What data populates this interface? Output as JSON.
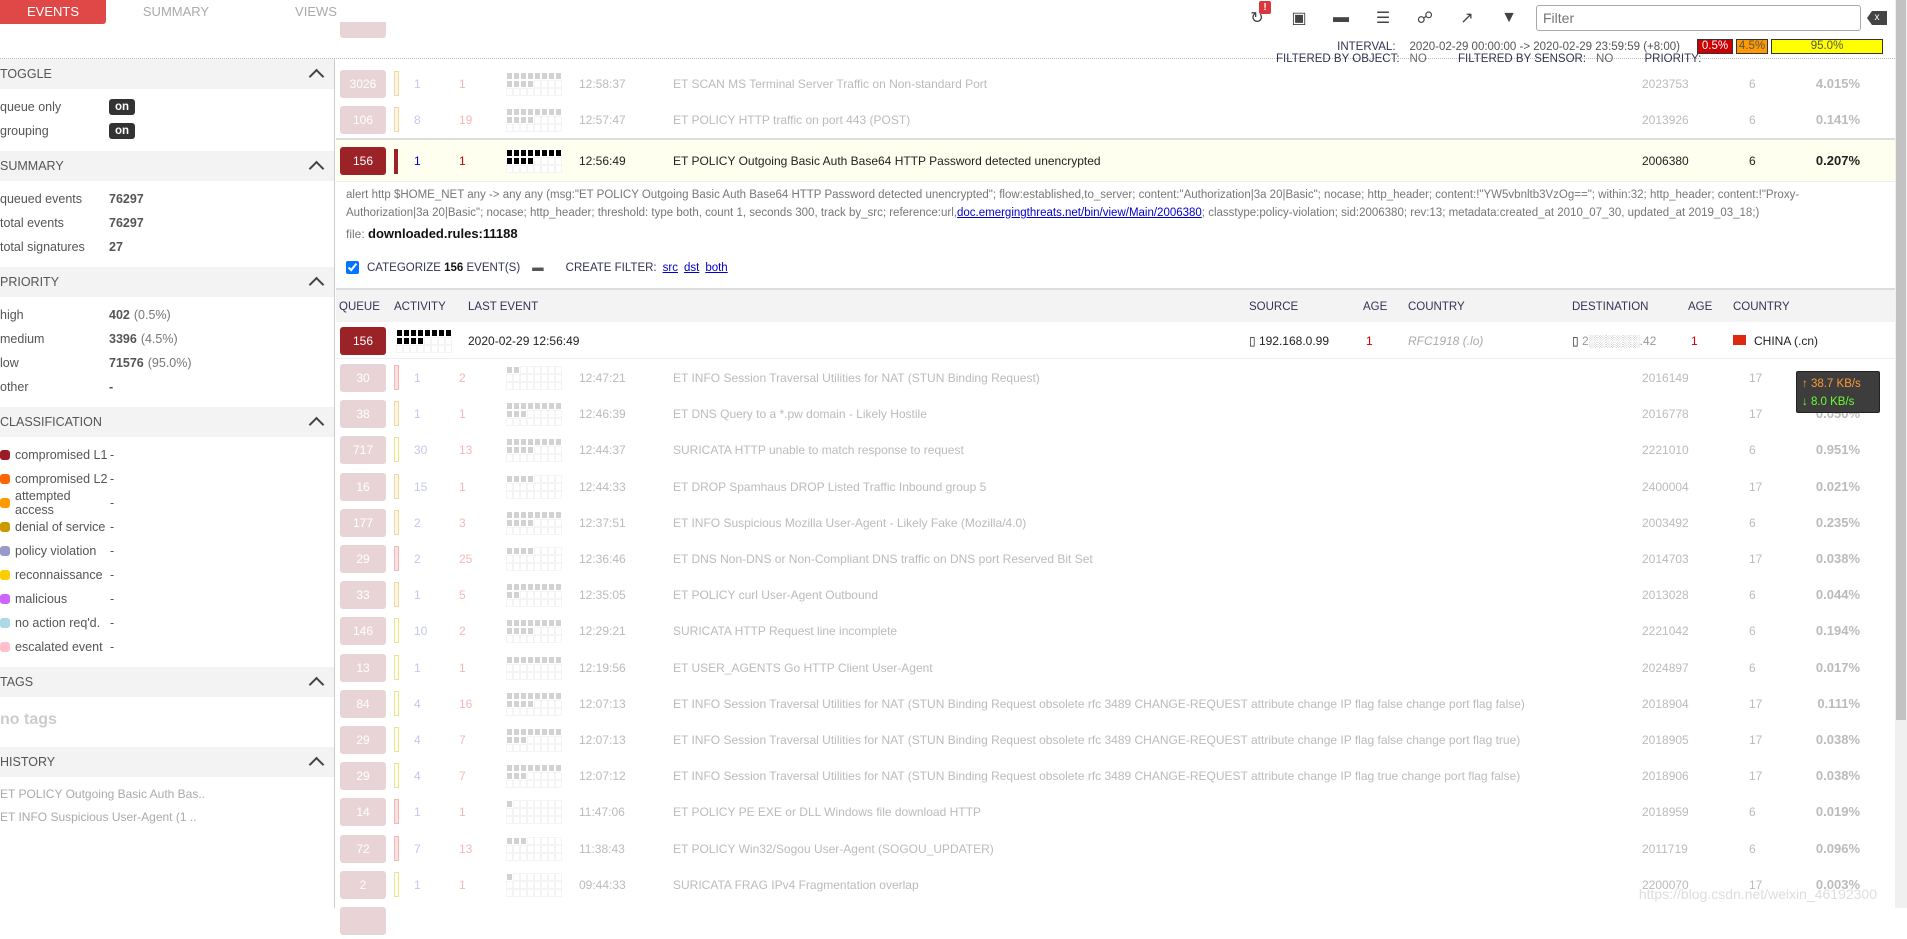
{
  "tabs": [
    "EVENTS",
    "SUMMARY",
    "VIEWS"
  ],
  "sidebar": {
    "toggle": {
      "title": "TOGGLE",
      "items": [
        {
          "label": "queue only",
          "value": "on"
        },
        {
          "label": "grouping",
          "value": "on"
        }
      ]
    },
    "summary": {
      "title": "SUMMARY",
      "items": [
        {
          "label": "queued events",
          "value": "76297"
        },
        {
          "label": "total events",
          "value": "76297"
        },
        {
          "label": "total signatures",
          "value": "27"
        }
      ]
    },
    "priority": {
      "title": "PRIORITY",
      "items": [
        {
          "label": "high",
          "value": "402",
          "pct": "(0.5%)"
        },
        {
          "label": "medium",
          "value": "3396",
          "pct": "(4.5%)"
        },
        {
          "label": "low",
          "value": "71576",
          "pct": "(95.0%)"
        },
        {
          "label": "other",
          "value": "-",
          "pct": ""
        }
      ]
    },
    "classification": {
      "title": "CLASSIFICATION",
      "items": [
        {
          "label": "compromised L1",
          "value": "-",
          "color": "#9b1c22"
        },
        {
          "label": "compromised L2",
          "value": "-",
          "color": "#ff6600"
        },
        {
          "label": "attempted access",
          "value": "-",
          "color": "#ff9900"
        },
        {
          "label": "denial of service",
          "value": "-",
          "color": "#cc9900"
        },
        {
          "label": "policy violation",
          "value": "-",
          "color": "#9999cc"
        },
        {
          "label": "reconnaissance",
          "value": "-",
          "color": "#ffcc00"
        },
        {
          "label": "malicious",
          "value": "-",
          "color": "#cc66ff"
        },
        {
          "label": "no action req'd.",
          "value": "-",
          "color": "#add8e6"
        },
        {
          "label": "escalated event",
          "value": "-",
          "color": "#ffc0cb"
        }
      ]
    },
    "tags": {
      "title": "TAGS",
      "empty": "no tags"
    },
    "history": {
      "title": "HISTORY",
      "items": [
        "ET POLICY Outgoing Basic Auth Bas..",
        "ET INFO Suspicious User-Agent (1 .."
      ]
    }
  },
  "toolbar": {
    "icons": [
      "refresh-icon",
      "window-icon",
      "comment-icon",
      "list-icon",
      "graph-icon",
      "external-link-icon",
      "filter-icon"
    ],
    "alert_badge": "!",
    "filter_placeholder": "Filter",
    "clear": "x"
  },
  "info": {
    "interval_label": "INTERVAL:",
    "interval": "2020-02-29 00:00:00 -> 2020-02-29 23:59:59 (+8:00)",
    "filtered_object_label": "FILTERED BY OBJECT:",
    "filtered_object": "NO",
    "filtered_sensor_label": "FILTERED BY SENSOR:",
    "filtered_sensor": "NO",
    "priority_label": "PRIORITY:",
    "priority_bars": [
      {
        "label": "0.5%",
        "color": "#cc0000",
        "text": "#ffffff",
        "fraction": 0.005
      },
      {
        "label": "4.5%",
        "color": "#ff9900",
        "text": "#333333",
        "fraction": 0.045
      },
      {
        "label": "95.0%",
        "color": "#ffff00",
        "text": "#333333",
        "fraction": 0.95
      }
    ]
  },
  "rows_top": [
    {
      "queue": "3026",
      "c1": "1",
      "c2": "1",
      "time": "12:58:37",
      "sig": "ET SCAN MS Terminal Server Traffic on Non-standard Port",
      "sid": "2023753",
      "rev": "6",
      "pct": "4.015%",
      "act": 12,
      "bar": "y"
    },
    {
      "queue": "106",
      "c1": "8",
      "c2": "19",
      "time": "12:57:47",
      "sig": "ET POLICY HTTP traffic on port 443 (POST)",
      "sid": "2013926",
      "rev": "6",
      "pct": "0.141%",
      "act": 12,
      "bar": "y"
    }
  ],
  "selected": {
    "queue": "156",
    "c1": "1",
    "c2": "1",
    "time": "12:56:49",
    "sig": "ET POLICY Outgoing Basic Auth Base64 HTTP Password detected unencrypted",
    "sid": "2006380",
    "rev": "6",
    "pct": "0.207%",
    "act": 12,
    "rule_pre": "alert http $HOME_NET any -> any any (msg:\"ET POLICY Outgoing Basic Auth Base64 HTTP Password detected unencrypted\"; flow:established,to_server; content:\"Authorization|3a 20|Basic\"; nocase; http_header; content:!\"YW5vbnltb3VzOg==\"; within:32; http_header; content:!\"Proxy-Authorization|3a 20|Basic\"; nocase; http_header; threshold: type both, count 1, seconds 300, track by_src; reference:url,",
    "rule_link": "doc.emergingthreats.net/bin/view/Main/2006380",
    "rule_post": "; classtype:policy-violation; sid:2006380; rev:13; metadata:created_at 2010_07_30, updated_at 2019_03_18;)",
    "file_label": "file:",
    "file": "downloaded.rules:11188",
    "categorize_label": "CATEGORIZE",
    "categorize_count": "156",
    "categorize_suffix": "EVENT(S)",
    "create_filter_label": "CREATE FILTER:",
    "filters": [
      "src",
      "dst",
      "both"
    ],
    "headers": [
      "QUEUE",
      "ACTIVITY",
      "LAST EVENT",
      "SOURCE",
      "AGE",
      "COUNTRY",
      "DESTINATION",
      "AGE",
      "COUNTRY"
    ],
    "detail": {
      "queue": "156",
      "last_event": "2020-02-29 12:56:49",
      "source": "192.168.0.99",
      "src_age": "1",
      "src_country": "RFC1918 (.lo)",
      "destination": "2░░░░░░.42",
      "dst_age": "1",
      "dst_country": "CHINA (.cn)"
    }
  },
  "network": {
    "up": "↑ 38.7 KB/s",
    "down": "↓ 8.0 KB/s"
  },
  "rows": [
    {
      "queue": "30",
      "c1": "1",
      "c2": "2",
      "time": "12:47:21",
      "sig": "ET INFO Session Traversal Utilities for NAT (STUN Binding Request)",
      "sid": "2016149",
      "rev": "17",
      "pct": "0.040%",
      "act": 2,
      "bar": "r"
    },
    {
      "queue": "38",
      "c1": "1",
      "c2": "1",
      "time": "12:46:39",
      "sig": "ET DNS Query to a *.pw domain - Likely Hostile",
      "sid": "2016778",
      "rev": "17",
      "pct": "0.050%",
      "act": 11,
      "bar": "y"
    },
    {
      "queue": "717",
      "c1": "30",
      "c2": "13",
      "time": "12:44:37",
      "sig": "SURICATA HTTP unable to match response to request",
      "sid": "2221010",
      "rev": "6",
      "pct": "0.951%",
      "act": 12,
      "bar": "l"
    },
    {
      "queue": "16",
      "c1": "15",
      "c2": "1",
      "time": "12:44:33",
      "sig": "ET DROP Spamhaus DROP Listed Traffic Inbound group 5",
      "sid": "2400004",
      "rev": "17",
      "pct": "0.021%",
      "act": 4,
      "bar": "y"
    },
    {
      "queue": "177",
      "c1": "2",
      "c2": "3",
      "time": "12:37:51",
      "sig": "ET INFO Suspicious Mozilla User-Agent - Likely Fake (Mozilla/4.0)",
      "sid": "2003492",
      "rev": "6",
      "pct": "0.235%",
      "act": 12,
      "bar": "y"
    },
    {
      "queue": "29",
      "c1": "2",
      "c2": "25",
      "time": "12:36:46",
      "sig": "ET DNS Non-DNS or Non-Compliant DNS traffic on DNS port Reserved Bit Set",
      "sid": "2014703",
      "rev": "17",
      "pct": "0.038%",
      "act": 4,
      "bar": "r"
    },
    {
      "queue": "33",
      "c1": "1",
      "c2": "5",
      "time": "12:35:05",
      "sig": "ET POLICY curl User-Agent Outbound",
      "sid": "2013028",
      "rev": "6",
      "pct": "0.044%",
      "act": 10,
      "bar": "y"
    },
    {
      "queue": "146",
      "c1": "10",
      "c2": "2",
      "time": "12:29:21",
      "sig": "SURICATA HTTP Request line incomplete",
      "sid": "2221042",
      "rev": "6",
      "pct": "0.194%",
      "act": 12,
      "bar": "l"
    },
    {
      "queue": "13",
      "c1": "1",
      "c2": "1",
      "time": "12:19:56",
      "sig": "ET USER_AGENTS Go HTTP Client User-Agent",
      "sid": "2024897",
      "rev": "6",
      "pct": "0.017%",
      "act": 8,
      "bar": "l"
    },
    {
      "queue": "84",
      "c1": "4",
      "c2": "16",
      "time": "12:07:13",
      "sig": "ET INFO Session Traversal Utilities for NAT (STUN Binding Request obsolete rfc 3489 CHANGE-REQUEST attribute change IP flag false change port flag false)",
      "sid": "2018904",
      "rev": "17",
      "pct": "0.111%",
      "act": 12,
      "bar": "l"
    },
    {
      "queue": "29",
      "c1": "4",
      "c2": "7",
      "time": "12:07:13",
      "sig": "ET INFO Session Traversal Utilities for NAT (STUN Binding Request obsolete rfc 3489 CHANGE-REQUEST attribute change IP flag false change port flag true)",
      "sid": "2018905",
      "rev": "17",
      "pct": "0.038%",
      "act": 11,
      "bar": "l"
    },
    {
      "queue": "29",
      "c1": "4",
      "c2": "7",
      "time": "12:07:12",
      "sig": "ET INFO Session Traversal Utilities for NAT (STUN Binding Request obsolete rfc 3489 CHANGE-REQUEST attribute change IP flag true change port flag false)",
      "sid": "2018906",
      "rev": "17",
      "pct": "0.038%",
      "act": 11,
      "bar": "l"
    },
    {
      "queue": "14",
      "c1": "1",
      "c2": "1",
      "time": "11:47:06",
      "sig": "ET POLICY PE EXE or DLL Windows file download HTTP",
      "sid": "2018959",
      "rev": "6",
      "pct": "0.019%",
      "act": 1,
      "bar": "r"
    },
    {
      "queue": "72",
      "c1": "7",
      "c2": "13",
      "time": "11:38:43",
      "sig": "ET POLICY Win32/Sogou User-Agent (SOGOU_UPDATER)",
      "sid": "2011719",
      "rev": "6",
      "pct": "0.096%",
      "act": 3,
      "bar": "r"
    },
    {
      "queue": "2",
      "c1": "1",
      "c2": "1",
      "time": "09:44:33",
      "sig": "SURICATA FRAG IPv4 Fragmentation overlap",
      "sid": "2200070",
      "rev": "17",
      "pct": "0.003%",
      "act": 1,
      "bar": "l"
    }
  ],
  "watermark": "https://blog.csdn.net/weixin_46192300"
}
